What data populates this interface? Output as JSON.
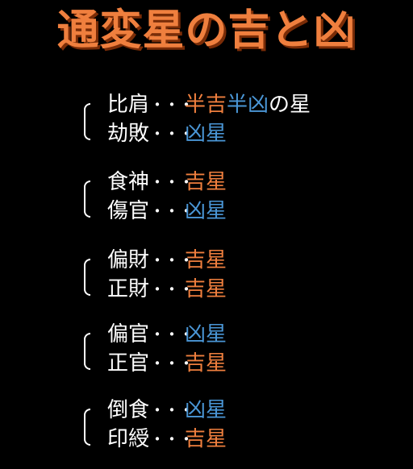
{
  "title": "通変星の吉と凶",
  "colors": {
    "title": "#ef7f3e",
    "kichi": "#ef7f3e",
    "kyo": "#4a96d6",
    "text": "#ffffff",
    "background": "#000000"
  },
  "separator": "・・・",
  "groups": [
    {
      "first": {
        "name": "比肩",
        "parts": [
          {
            "text": "半吉",
            "tone": "kichi"
          },
          {
            "text": "半凶",
            "tone": "kyo"
          },
          {
            "text": "の星",
            "tone": "plain"
          }
        ]
      },
      "second": {
        "name": "劫敗",
        "parts": [
          {
            "text": "凶星",
            "tone": "kyo"
          }
        ]
      }
    },
    {
      "first": {
        "name": "食神",
        "parts": [
          {
            "text": "吉星",
            "tone": "kichi"
          }
        ]
      },
      "second": {
        "name": "傷官",
        "parts": [
          {
            "text": "凶星",
            "tone": "kyo"
          }
        ]
      }
    },
    {
      "first": {
        "name": "偏財",
        "parts": [
          {
            "text": "吉星",
            "tone": "kichi"
          }
        ]
      },
      "second": {
        "name": "正財",
        "parts": [
          {
            "text": "吉星",
            "tone": "kichi"
          }
        ]
      }
    },
    {
      "first": {
        "name": "偏官",
        "parts": [
          {
            "text": "凶星",
            "tone": "kyo"
          }
        ]
      },
      "second": {
        "name": "正官",
        "parts": [
          {
            "text": "吉星",
            "tone": "kichi"
          }
        ]
      }
    },
    {
      "first": {
        "name": "倒食",
        "parts": [
          {
            "text": "凶星",
            "tone": "kyo"
          }
        ]
      },
      "second": {
        "name": "印綬",
        "parts": [
          {
            "text": "吉星",
            "tone": "kichi"
          }
        ]
      }
    }
  ]
}
